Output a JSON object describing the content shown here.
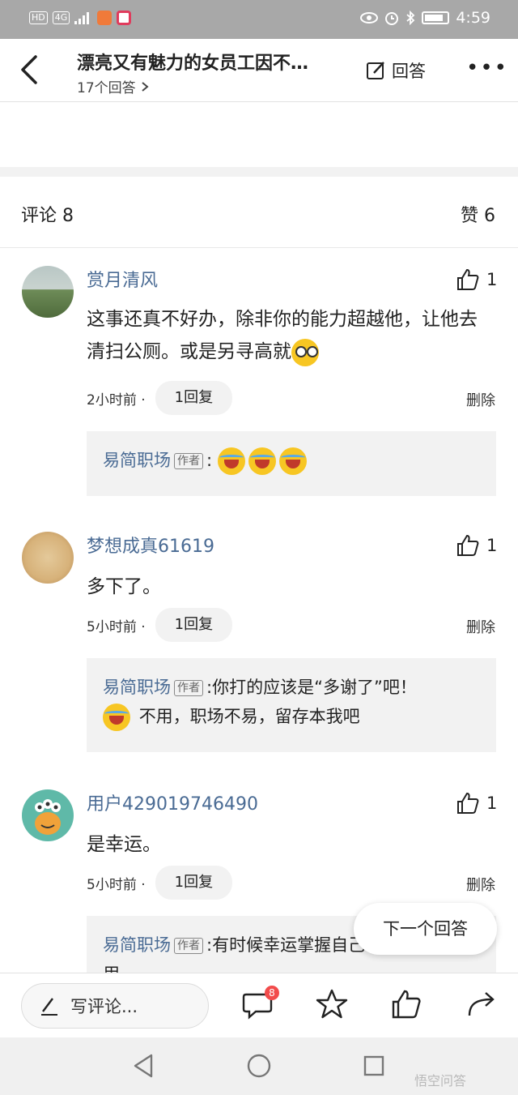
{
  "status_bar": {
    "left_chips": [
      "HD",
      "4G"
    ],
    "time": "4:59",
    "colors": {
      "background": "#a8a8a8"
    }
  },
  "header": {
    "title": "漂亮又有魅力的女员工因不…",
    "answer_count": "17个回答",
    "answer_label": "回答"
  },
  "counts": {
    "comments_label": "评论 8",
    "likes_label": "赞 6"
  },
  "comments": [
    {
      "username": "赏月清风",
      "likes": "1",
      "text": "这事还真不好办，除非你的能力超越他，让他去清扫公厕。或是另寻高就",
      "time": "2小时前 ·",
      "reply_count": "1回复",
      "delete": "删除",
      "reply": {
        "name": "易简职场",
        "tag": "作者",
        "sep": ":",
        "text": ""
      }
    },
    {
      "username": "梦想成真61619",
      "likes": "1",
      "text": "多下了。",
      "time": "5小时前 ·",
      "reply_count": "1回复",
      "delete": "删除",
      "reply": {
        "name": "易简职场",
        "tag": "作者",
        "sep": ":",
        "text": "你打的应该是“多谢了”吧！",
        "text2": "不用，职场不易，留存本我吧"
      }
    },
    {
      "username": "用户429019746490",
      "likes": "1",
      "text": "是幸运。",
      "time": "5小时前 ·",
      "reply_count": "1回复",
      "delete": "删除",
      "reply": {
        "name": "易简职场",
        "tag": "作者",
        "sep": ":",
        "text": "有时候幸运掌握自己手里",
        "text2": "用"
      }
    }
  ],
  "next_answer": "下一个回答",
  "bottom_bar": {
    "write_placeholder": "写评论...",
    "comment_badge": "8"
  },
  "watermark": "悟空问答",
  "colors": {
    "username": "#4a6b94",
    "badge": "#f24b4b",
    "reply_bg": "#f2f2f2"
  }
}
